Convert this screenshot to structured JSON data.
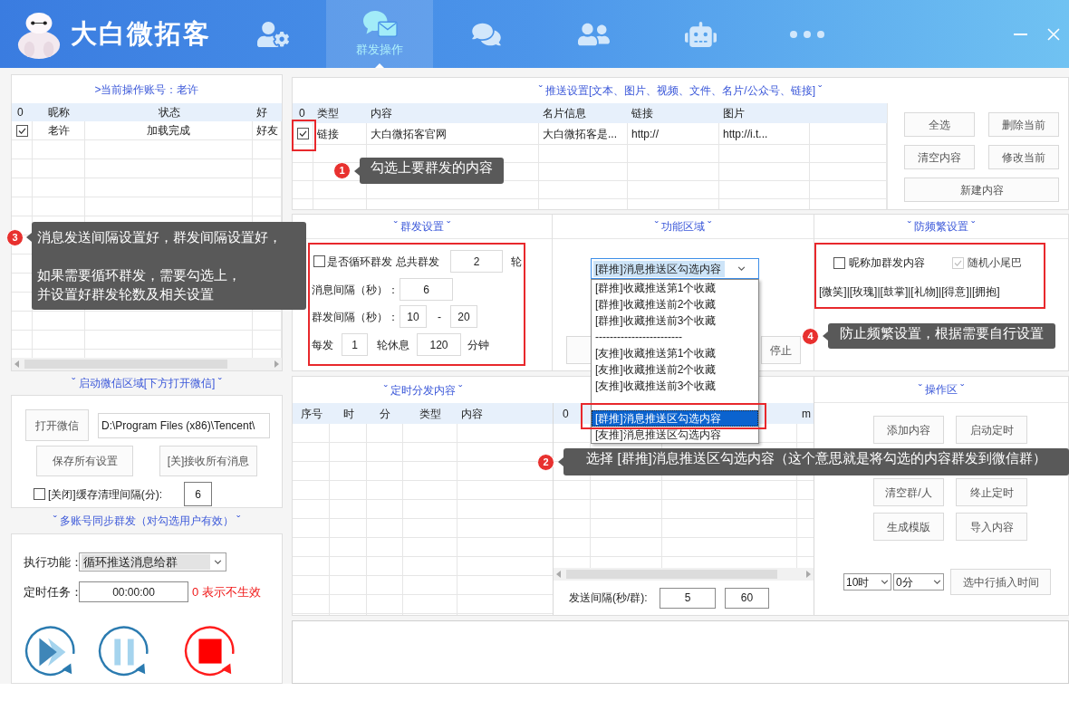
{
  "title_bar": {
    "app_name": "大白微拓客",
    "tabs": [
      {
        "kind": "user-gear",
        "selected": false
      },
      {
        "kind": "chat-mail",
        "label": "群发操作",
        "selected": true
      },
      {
        "kind": "chat-gear",
        "selected": false
      },
      {
        "kind": "users",
        "selected": false
      },
      {
        "kind": "robot",
        "selected": false
      },
      {
        "kind": "more",
        "selected": false
      }
    ]
  },
  "account_panel": {
    "title": ">当前操作账号：老许",
    "check_column": "0",
    "columns": [
      "昵称",
      "状态",
      "好"
    ],
    "rows": [
      {
        "checked": true,
        "cells": [
          "老许",
          "加载完成",
          "好友"
        ]
      }
    ]
  },
  "wechat_panel": {
    "title": "ˇ 启动微信区域[下方打开微信] ˇ",
    "open_button": "打开微信",
    "path": "D:\\Program Files (x86)\\Tencent\\",
    "save_button": "保存所有设置",
    "receive_button": "[关]接收所有消息",
    "cache": {
      "label": "[关闭]缓存清理间隔(分):",
      "checked": false,
      "value": "6"
    }
  },
  "sync_panel": {
    "title": "ˇ 多账号同步群发（对勾选用户有效） ˇ",
    "function_label": "执行功能：",
    "function_value": "循环推送消息给群",
    "timer_label": "定时任务：",
    "timer_value": "00:00:00",
    "timer_hint": "0 表示不生效",
    "controls": [
      {
        "kind": "play"
      },
      {
        "kind": "pause"
      },
      {
        "kind": "stop"
      }
    ]
  },
  "push_panel": {
    "title": "ˇ 推送设置[文本、图片、视频、文件、名片/公众号、链接] ˇ",
    "check_column": "0",
    "columns": [
      "类型",
      "内容",
      "名片信息",
      "链接",
      "图片"
    ],
    "rows": [
      {
        "checked": true,
        "cells": [
          "链接",
          "大白微拓客官网",
          "大白微拓客是...",
          "http://",
          "http://i.t..."
        ]
      }
    ],
    "buttons": [
      "全选",
      "删除当前",
      "清空内容",
      "修改当前",
      "新建内容"
    ]
  },
  "mass_send": {
    "title": "ˇ 群发设置 ˇ",
    "loop": {
      "label": "是否循环群发",
      "checked": false
    },
    "total_label": "总共群发",
    "total_value": "2",
    "total_unit": "轮",
    "message_interval_label": "消息间隔（秒）：",
    "message_interval": "6",
    "group_interval_label": "群发间隔（秒）：",
    "group_interval_from": "10",
    "range_dash": "-",
    "group_interval_to": "20",
    "every_label": "每发",
    "every_value": "1",
    "rest_label": "轮休息",
    "rest_value": "120",
    "rest_unit": "分钟"
  },
  "function_area": {
    "title": "ˇ 功能区域 ˇ",
    "select": {
      "value": "[群推]消息推送区勾选内容",
      "expanded": true,
      "options": [
        {
          "kind": "option",
          "label": "[群推]收藏推送第1个收藏",
          "selected": false
        },
        {
          "kind": "option",
          "label": "[群推]收藏推送前2个收藏",
          "selected": false
        },
        {
          "kind": "option",
          "label": "[群推]收藏推送前3个收藏",
          "selected": false
        },
        {
          "kind": "option",
          "label": "------------------------",
          "selected": false
        },
        {
          "kind": "option",
          "label": "[友推]收藏推送第1个收藏",
          "selected": false
        },
        {
          "kind": "option",
          "label": "[友推]收藏推送前2个收藏",
          "selected": false
        },
        {
          "kind": "option",
          "label": "[友推]收藏推送前3个收藏",
          "selected": false
        },
        {
          "kind": "blank"
        },
        {
          "kind": "option",
          "label": "[群推]消息推送区勾选内容",
          "selected": true
        },
        {
          "kind": "option",
          "label": "[友推]消息推送区勾选内容",
          "selected": false
        }
      ]
    },
    "stop_button": "停止"
  },
  "anti_frequency": {
    "title": "ˇ 防频繁设置 ˇ",
    "options": [
      {
        "label": "昵称加群发内容",
        "checked": false,
        "disabled": false
      },
      {
        "label": "随机小尾巴",
        "checked": true,
        "disabled": true
      }
    ],
    "emoji_tail": "[微笑]|[玫瑰]|[鼓掌]|[礼物]|[得意]|[拥抱]"
  },
  "schedule_panel": {
    "title": "ˇ 定时分发内容 ˇ",
    "columns": [
      "序号",
      "时",
      "分",
      "类型",
      "内容"
    ],
    "side_columns": [
      "0",
      "m"
    ],
    "send_interval_label": "发送间隔(秒/群):",
    "send_interval_min": "5",
    "send_interval_max": "60"
  },
  "operation_area": {
    "title": "ˇ 操作区 ˇ",
    "buttons": [
      "添加内容",
      "启动定时",
      "清空群/人",
      "终止定时",
      "生成模版",
      "导入内容"
    ],
    "hour": "10时",
    "minute": "0分",
    "insert_button": "选中行插入时间"
  },
  "callouts": [
    {
      "number": "1",
      "paragraphs": [
        [
          "勾选上要群发的内容"
        ]
      ]
    },
    {
      "number": "2",
      "paragraphs": [
        [
          "选择 [群推]消息推送区勾选内容（这个意思就是将勾选的内容群发到微信群）"
        ]
      ]
    },
    {
      "number": "3",
      "paragraphs": [
        [
          "消息发送间隔设置好，群发间隔设置好，"
        ],
        [
          "如果需要循环群发，需要勾选上，",
          "并设置好群发轮数及相关设置"
        ]
      ]
    },
    {
      "number": "4",
      "paragraphs": [
        [
          "防止频繁设置，根据需要自行设置"
        ]
      ]
    }
  ]
}
